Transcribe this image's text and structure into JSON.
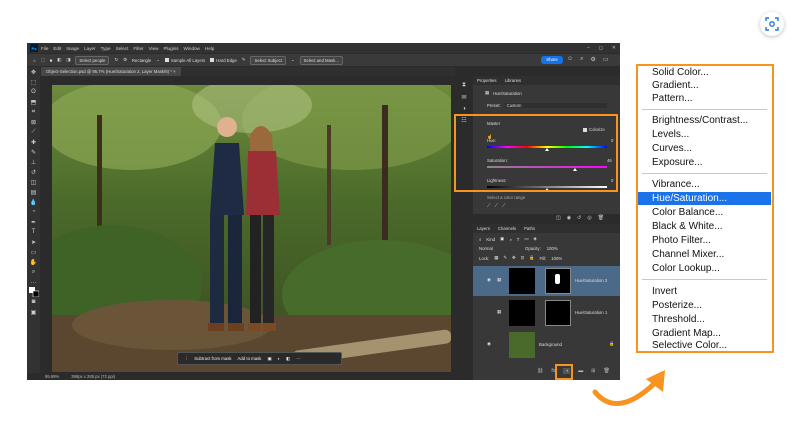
{
  "menubar": {
    "items": [
      "File",
      "Edit",
      "Image",
      "Layer",
      "Type",
      "Select",
      "Filter",
      "View",
      "Plugins",
      "Window",
      "Help"
    ],
    "window_controls": [
      "–",
      "◻",
      "✕"
    ]
  },
  "options_bar": {
    "select_people": "Select people",
    "tool_mode": "Rectangle",
    "sample_all_layers": "Sample All Layers",
    "hard_edge": "Hard Edge",
    "select_subject": "Select Subject",
    "select_and_mask": "Select and Mask...",
    "share": "Share"
  },
  "document_tab": {
    "title": "Object-Selection.psd @ 95.7% (Hue/Saturation 2, Layer Mask/8) *"
  },
  "status_bar": {
    "zoom": "95.69%",
    "doc_size": "399px x 285 px (72 ppi)"
  },
  "context_bar": {
    "subtract": "Subtract from mask",
    "add": "Add to mask"
  },
  "properties_panel": {
    "tabs": [
      "Properties",
      "Libraries"
    ],
    "adjustment_title": "Hue/Saturation",
    "preset_label": "Preset:",
    "preset_value": "Custom",
    "channel": "Master",
    "colorize": "Colorize",
    "hue_label": "Hue:",
    "hue_value": "0",
    "saturation_label": "Saturation:",
    "saturation_value": "46",
    "lightness_label": "Lightness:",
    "lightness_value": "0",
    "hint": "Select a color range"
  },
  "layers_panel": {
    "tabs": [
      "Layers",
      "Channels",
      "Paths"
    ],
    "kind": "Kind",
    "blend_mode": "Normal",
    "opacity_label": "Opacity:",
    "opacity_value": "100%",
    "lock_label": "Lock:",
    "fill_label": "Fill:",
    "fill_value": "100%",
    "layers": [
      {
        "name": "Hue/Saturation 2",
        "selected": true
      },
      {
        "name": "Hue/Saturation 1",
        "selected": false
      },
      {
        "name": "Background",
        "selected": false
      }
    ]
  },
  "adjustment_menu": {
    "groups": [
      [
        "Solid Color...",
        "Gradient...",
        "Pattern..."
      ],
      [
        "Brightness/Contrast...",
        "Levels...",
        "Curves...",
        "Exposure..."
      ],
      [
        "Vibrance...",
        "Hue/Saturation...",
        "Color Balance...",
        "Black & White...",
        "Photo Filter...",
        "Channel Mixer...",
        "Color Lookup..."
      ],
      [
        "Invert",
        "Posterize...",
        "Threshold...",
        "Gradient Map...",
        "Selective Color..."
      ]
    ],
    "selected": "Hue/Saturation..."
  },
  "colors": {
    "highlight_orange": "#f7931e",
    "menu_selection": "#1a73e8",
    "share_button": "#1473e6",
    "selected_layer": "#4b6a8a"
  }
}
